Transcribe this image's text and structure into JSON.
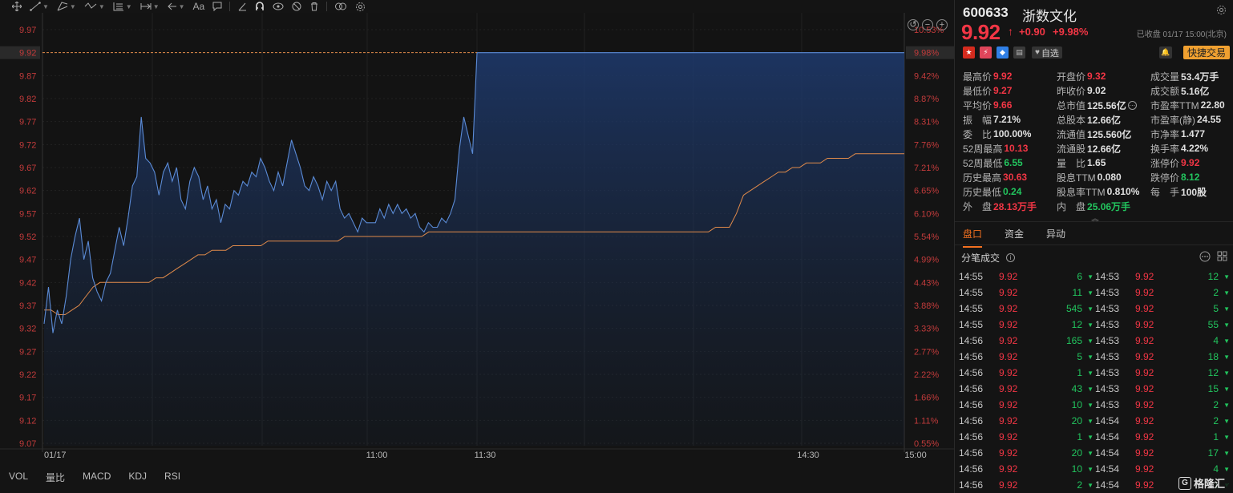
{
  "toolbar": {
    "text_tool_label": "Aa"
  },
  "chart": {
    "date_label": "01/17",
    "y_left_ticks": [
      "9.97",
      "9.92",
      "9.87",
      "9.82",
      "9.77",
      "9.72",
      "9.67",
      "9.62",
      "9.57",
      "9.52",
      "9.47",
      "9.42",
      "9.37",
      "9.32",
      "9.27",
      "9.22",
      "9.17",
      "9.12",
      "9.07"
    ],
    "y_right_ticks": [
      "10.53%",
      "9.98%",
      "9.42%",
      "8.87%",
      "8.31%",
      "7.76%",
      "7.21%",
      "6.65%",
      "6.10%",
      "5.54%",
      "4.99%",
      "4.43%",
      "3.88%",
      "3.33%",
      "2.77%",
      "2.22%",
      "1.66%",
      "1.11%",
      "0.55%"
    ],
    "x_ticks": [
      "11:00",
      "11:30",
      "14:30",
      "15:00"
    ],
    "current_price_label": "9.92",
    "current_pct_label": "9.98%",
    "colors": {
      "price_line": "#5b8bd6",
      "avg_line": "#e08a4a",
      "up": "#f23645",
      "down": "#22c55e",
      "accent": "#f27020"
    }
  },
  "chart_data": {
    "type": "line",
    "ylim": [
      9.02,
      10.0
    ],
    "prev_close": 9.02,
    "limit_price": 9.92,
    "x_ticks": [
      "01/17",
      "11:00",
      "11:30",
      "14:30",
      "15:00"
    ],
    "series": [
      {
        "values": [
          9.33,
          9.41,
          9.31,
          9.36,
          9.33,
          9.39,
          9.47,
          9.52,
          9.56,
          9.47,
          9.51,
          9.43,
          9.4,
          9.38,
          9.42,
          9.44,
          9.49,
          9.54,
          9.5,
          9.56,
          9.63,
          9.65,
          9.78,
          9.69,
          9.68,
          9.66,
          9.61,
          9.66,
          9.68,
          9.64,
          9.67,
          9.6,
          9.58,
          9.64,
          9.67,
          9.65,
          9.6,
          9.63,
          9.58,
          9.6,
          9.55,
          9.59,
          9.58,
          9.62,
          9.61,
          9.64,
          9.63,
          9.66,
          9.65,
          9.69,
          9.67,
          9.64,
          9.62,
          9.66,
          9.63,
          9.68,
          9.73,
          9.7,
          9.67,
          9.63,
          9.62,
          9.65,
          9.63,
          9.6,
          9.64,
          9.62,
          9.64,
          9.58,
          9.56,
          9.57,
          9.55,
          9.53,
          9.56,
          9.55,
          9.55,
          9.55,
          9.58,
          9.56,
          9.59,
          9.57,
          9.59,
          9.57,
          9.58,
          9.56,
          9.57,
          9.54,
          9.53,
          9.55,
          9.54,
          9.54,
          9.56,
          9.55,
          9.57,
          9.6,
          9.71,
          9.78,
          9.74,
          9.7,
          9.92
        ]
      },
      {
        "values": [
          9.36,
          9.36,
          9.35,
          9.35,
          9.36,
          9.37,
          9.39,
          9.41,
          9.42,
          9.42,
          9.42,
          9.42,
          9.42,
          9.42,
          9.42,
          9.42,
          9.43,
          9.43,
          9.44,
          9.45,
          9.46,
          9.47,
          9.48,
          9.48,
          9.49,
          9.49,
          9.49,
          9.5,
          9.5,
          9.5,
          9.5,
          9.5,
          9.51,
          9.51,
          9.51,
          9.51,
          9.51,
          9.51,
          9.51,
          9.51,
          9.51,
          9.51,
          9.51,
          9.52,
          9.52,
          9.52,
          9.52,
          9.52,
          9.52,
          9.52,
          9.52,
          9.52,
          9.52,
          9.52,
          9.52,
          9.53,
          9.53,
          9.53,
          9.53,
          9.53,
          9.53,
          9.53,
          9.53,
          9.53,
          9.53,
          9.53,
          9.53,
          9.53,
          9.53,
          9.53,
          9.53,
          9.53,
          9.53,
          9.53,
          9.53,
          9.53,
          9.53,
          9.53,
          9.53,
          9.53,
          9.53,
          9.53,
          9.53,
          9.53,
          9.53,
          9.53,
          9.53,
          9.53,
          9.53,
          9.53,
          9.53,
          9.53,
          9.53,
          9.53,
          9.53,
          9.53,
          9.54,
          9.54,
          9.54,
          9.57,
          9.61,
          9.62,
          9.63,
          9.64,
          9.65,
          9.66,
          9.66,
          9.67,
          9.67,
          9.68,
          9.68,
          9.68,
          9.69,
          9.69,
          9.69,
          9.69,
          9.7,
          9.7,
          9.7,
          9.7,
          9.7,
          9.7,
          9.7,
          9.7
        ]
      }
    ]
  },
  "indicator_tabs": [
    "VOL",
    "量比",
    "MACD",
    "KDJ",
    "RSI"
  ],
  "stock": {
    "code": "600633",
    "name": "浙数文化",
    "price": "9.92",
    "arrow": "↑",
    "change": "+0.90",
    "change_pct": "+9.98%",
    "close_status": "已收盘 01/17 15:00(北京)",
    "watch_label": "自选",
    "quick_trade_label": "快捷交易"
  },
  "quote": [
    [
      {
        "label": "最高价",
        "value": "9.92",
        "color": "red"
      },
      {
        "label": "开盘价",
        "value": "9.32",
        "color": "red"
      },
      {
        "label": "成交量",
        "value": "53.4万手",
        "color": "white"
      }
    ],
    [
      {
        "label": "最低价",
        "value": "9.27",
        "color": "red"
      },
      {
        "label": "昨收价",
        "value": "9.02",
        "color": "white"
      },
      {
        "label": "成交额",
        "value": "5.16亿",
        "color": "white"
      }
    ],
    [
      {
        "label": "平均价",
        "value": "9.66",
        "color": "red"
      },
      {
        "label": "总市值",
        "value": "125.56亿",
        "color": "white",
        "info": true
      },
      {
        "label": "市盈率TTM",
        "value": "22.80",
        "color": "white"
      }
    ],
    [
      {
        "label": "振　幅",
        "value": "7.21%",
        "color": "white"
      },
      {
        "label": "总股本",
        "value": "12.66亿",
        "color": "white"
      },
      {
        "label": "市盈率(静)",
        "value": "24.55",
        "color": "white"
      }
    ],
    [
      {
        "label": "委　比",
        "value": "100.00%",
        "color": "white"
      },
      {
        "label": "流通值",
        "value": "125.560亿",
        "color": "white"
      },
      {
        "label": "市净率",
        "value": "1.477",
        "color": "white"
      }
    ],
    [
      {
        "label": "52周最高",
        "value": "10.13",
        "color": "red"
      },
      {
        "label": "流通股",
        "value": "12.66亿",
        "color": "white"
      },
      {
        "label": "换手率",
        "value": "4.22%",
        "color": "white"
      }
    ],
    [
      {
        "label": "52周最低",
        "value": "6.55",
        "color": "green"
      },
      {
        "label": "量　比",
        "value": "1.65",
        "color": "white"
      },
      {
        "label": "涨停价",
        "value": "9.92",
        "color": "red"
      }
    ],
    [
      {
        "label": "历史最高",
        "value": "30.63",
        "color": "red"
      },
      {
        "label": "股息TTM",
        "value": "0.080",
        "color": "white"
      },
      {
        "label": "跌停价",
        "value": "8.12",
        "color": "green"
      }
    ],
    [
      {
        "label": "历史最低",
        "value": "0.24",
        "color": "green"
      },
      {
        "label": "股息率TTM",
        "value": "0.810%",
        "color": "white"
      },
      {
        "label": "每　手",
        "value": "100股",
        "color": "white"
      }
    ],
    [
      {
        "label": "外　盘",
        "value": "28.13万手",
        "color": "red"
      },
      {
        "label": "内　盘",
        "value": "25.06万手",
        "color": "green"
      },
      {
        "label": "",
        "value": "",
        "color": "white"
      }
    ]
  ],
  "panel_tabs": [
    "盘口",
    "资金",
    "异动"
  ],
  "ticks_title": "分笔成交",
  "ticks_left": [
    [
      "14:55",
      "9.92",
      "6"
    ],
    [
      "14:55",
      "9.92",
      "11"
    ],
    [
      "14:55",
      "9.92",
      "545"
    ],
    [
      "14:55",
      "9.92",
      "12"
    ],
    [
      "14:56",
      "9.92",
      "165"
    ],
    [
      "14:56",
      "9.92",
      "5"
    ],
    [
      "14:56",
      "9.92",
      "1"
    ],
    [
      "14:56",
      "9.92",
      "43"
    ],
    [
      "14:56",
      "9.92",
      "10"
    ],
    [
      "14:56",
      "9.92",
      "20"
    ],
    [
      "14:56",
      "9.92",
      "1"
    ],
    [
      "14:56",
      "9.92",
      "20"
    ],
    [
      "14:56",
      "9.92",
      "10"
    ],
    [
      "14:56",
      "9.92",
      "2"
    ]
  ],
  "ticks_right": [
    [
      "14:53",
      "9.92",
      "12"
    ],
    [
      "14:53",
      "9.92",
      "2"
    ],
    [
      "14:53",
      "9.92",
      "5"
    ],
    [
      "14:53",
      "9.92",
      "55"
    ],
    [
      "14:53",
      "9.92",
      "4"
    ],
    [
      "14:53",
      "9.92",
      "18"
    ],
    [
      "14:53",
      "9.92",
      "12"
    ],
    [
      "14:53",
      "9.92",
      "15"
    ],
    [
      "14:53",
      "9.92",
      "2"
    ],
    [
      "14:54",
      "9.92",
      "2"
    ],
    [
      "14:54",
      "9.92",
      "1"
    ],
    [
      "14:54",
      "9.92",
      "17"
    ],
    [
      "14:54",
      "9.92",
      "4"
    ],
    [
      "14:54",
      "9.92",
      "1"
    ]
  ],
  "watermark": "格隆汇"
}
